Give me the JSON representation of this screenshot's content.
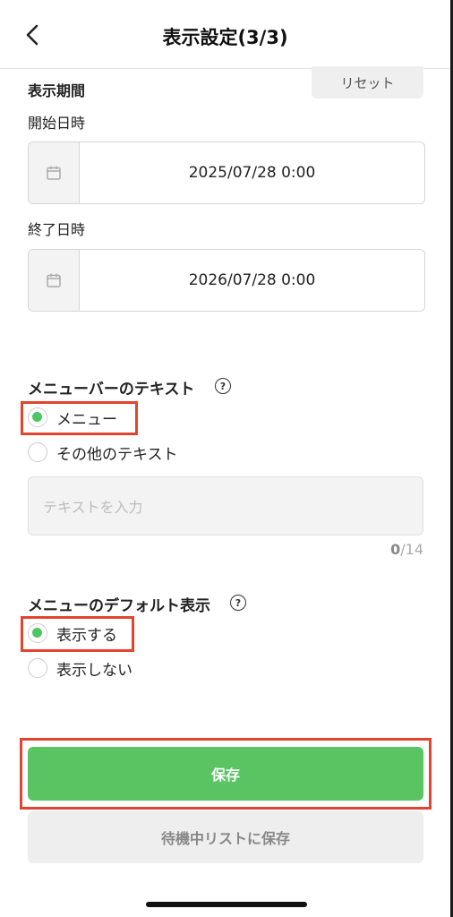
{
  "header": {
    "title": "表示設定(3/3)",
    "back_icon": "chevron-left-icon"
  },
  "period": {
    "heading": "表示期間",
    "reset_label": "リセット",
    "start_label": "開始日時",
    "start_value": "2025/07/28 0:00",
    "end_label": "終了日時",
    "end_value": "2026/07/28 0:00",
    "calendar_icon": "calendar-icon"
  },
  "menubar_text": {
    "heading": "メニューバーのテキスト",
    "help_glyph": "?",
    "options": [
      {
        "label": "メニュー",
        "selected": true
      },
      {
        "label": "その他のテキスト",
        "selected": false
      }
    ],
    "input_placeholder": "テキストを入力",
    "counter_current": "0",
    "counter_max": "/14"
  },
  "default_display": {
    "heading": "メニューのデフォルト表示",
    "help_glyph": "?",
    "options": [
      {
        "label": "表示する",
        "selected": true
      },
      {
        "label": "表示しない",
        "selected": false
      }
    ]
  },
  "actions": {
    "save_label": "保存",
    "waitlist_label": "待機中リストに保存"
  },
  "colors": {
    "accent": "#4cc764",
    "highlight": "#e3442f",
    "save_bg": "#5ac463"
  }
}
